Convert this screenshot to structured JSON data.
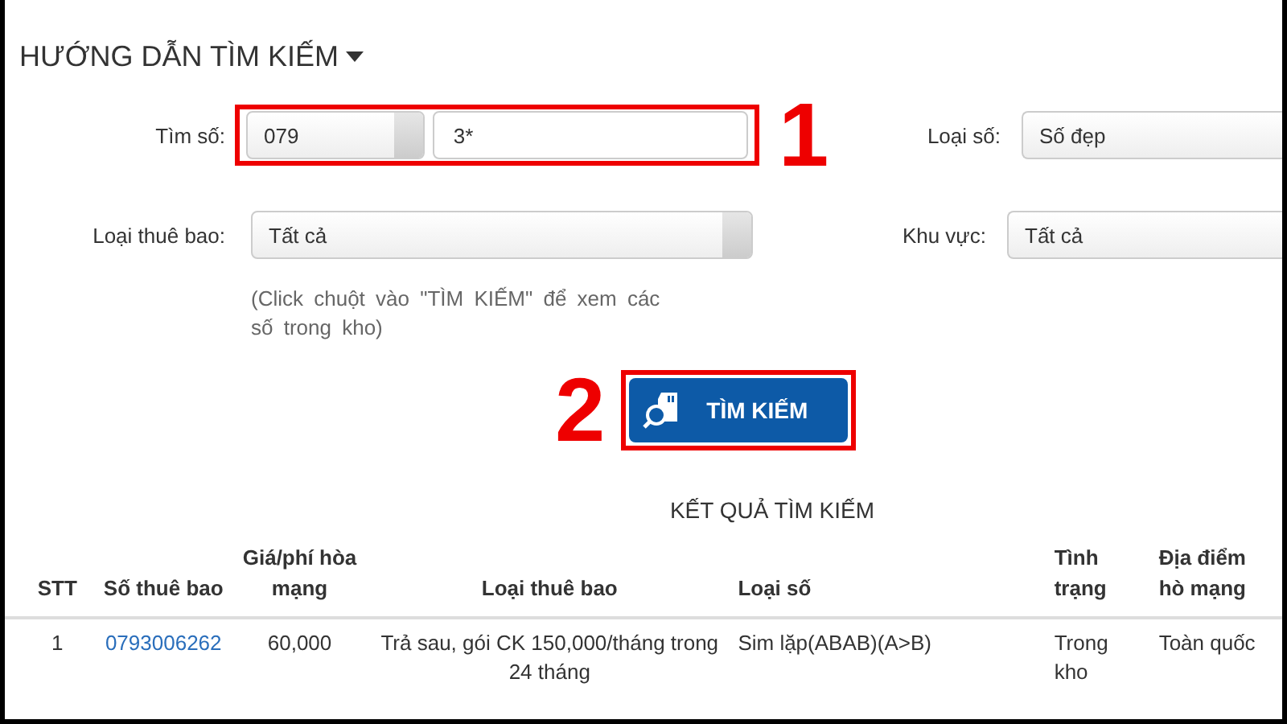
{
  "heading": {
    "title": "HƯỚNG DẪN TÌM KIẾM"
  },
  "search_number": {
    "label": "Tìm số:",
    "prefix": "079",
    "value": "3*"
  },
  "number_type": {
    "label": "Loại số:",
    "value": "Số đẹp"
  },
  "subscription_type": {
    "label": "Loại thuê bao:",
    "value": "Tất cả"
  },
  "region": {
    "label": "Khu vực:",
    "value": "Tất cả"
  },
  "hint": "(Click chuột vào \"TÌM KIẾM\" để xem các số trong kho)",
  "search_button": {
    "label": "TÌM KIẾM"
  },
  "annotations": [
    "1",
    "2"
  ],
  "results": {
    "title": "KẾT QUẢ TÌM KIẾM",
    "columns": [
      "STT",
      "Số thuê bao",
      "Giá/phí hòa mạng",
      "Loại thuê bao",
      "Loại số",
      "Tình trạng",
      "Địa điểm hò mạng"
    ],
    "rows": [
      [
        "1",
        "0793006262",
        "60,000",
        "Trả sau, gói CK 150,000/tháng trong 24 tháng",
        "Sim lặp(ABAB)(A>B)",
        "Trong kho",
        "Toàn quốc"
      ]
    ]
  }
}
